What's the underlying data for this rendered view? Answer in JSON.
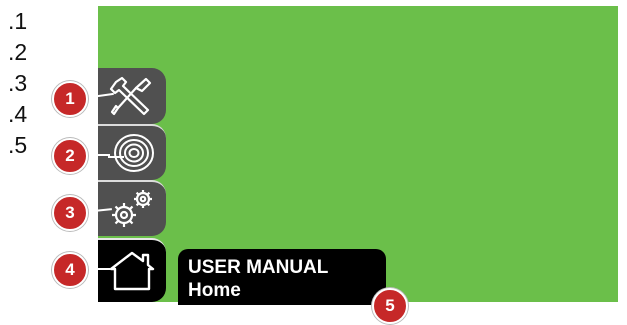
{
  "legend": [
    ".1",
    ".2",
    ".3",
    ".4",
    ".5"
  ],
  "menu": [
    {
      "icon": "tools-icon",
      "callout": "1"
    },
    {
      "icon": "spool-icon",
      "callout": "2"
    },
    {
      "icon": "gears-icon",
      "callout": "3"
    },
    {
      "icon": "home-icon",
      "callout": "4"
    }
  ],
  "status": {
    "title": "USER MANUAL",
    "subtitle": "Home",
    "callout": "5"
  },
  "colors": {
    "screen": "#6bbf4a",
    "menu_button": "#505050",
    "home_button": "#000000",
    "callout": "#c62828"
  }
}
